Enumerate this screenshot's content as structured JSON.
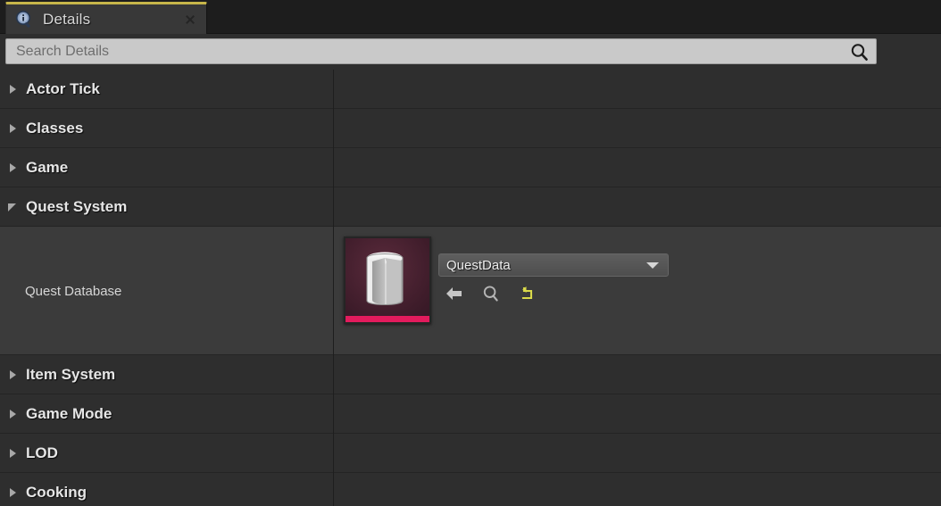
{
  "tab": {
    "label": "Details",
    "icon": "details-info-magnifier-icon",
    "close_icon": "close-icon",
    "active_accent": "#c7b64a"
  },
  "toolbar": {
    "search_placeholder": "Search Details",
    "search_value": "",
    "search_icon": "search-icon",
    "grid_button_icon": "column-grid-icon",
    "view_options_icon": "eye-icon"
  },
  "tree": {
    "categories": [
      {
        "label": "Actor Tick",
        "expanded": false
      },
      {
        "label": "Classes",
        "expanded": false
      },
      {
        "label": "Game",
        "expanded": false
      },
      {
        "label": "Quest System",
        "expanded": true
      },
      {
        "label": "Item System",
        "expanded": false
      },
      {
        "label": "Game Mode",
        "expanded": false
      },
      {
        "label": "LOD",
        "expanded": false
      },
      {
        "label": "Cooking",
        "expanded": false
      }
    ],
    "property": {
      "label": "Quest Database",
      "asset_name": "QuestData",
      "thumbnail": {
        "icon": "data-table-asset-icon",
        "background_color": "#3e1c2a",
        "accent_stripe_color": "#e31b5d"
      },
      "actions": [
        {
          "icon": "use-selected-asset-arrow-icon",
          "color": "#c6c6c6"
        },
        {
          "icon": "browse-to-asset-search-icon",
          "color": "#b4b4b4"
        },
        {
          "icon": "reset-to-default-icon",
          "color": "#d9d94a"
        }
      ]
    }
  },
  "colors": {
    "panel_background": "#2e2e2e",
    "property_row_background": "#3b3b3b",
    "tab_background": "#383838",
    "search_background": "#c9c9c9"
  }
}
